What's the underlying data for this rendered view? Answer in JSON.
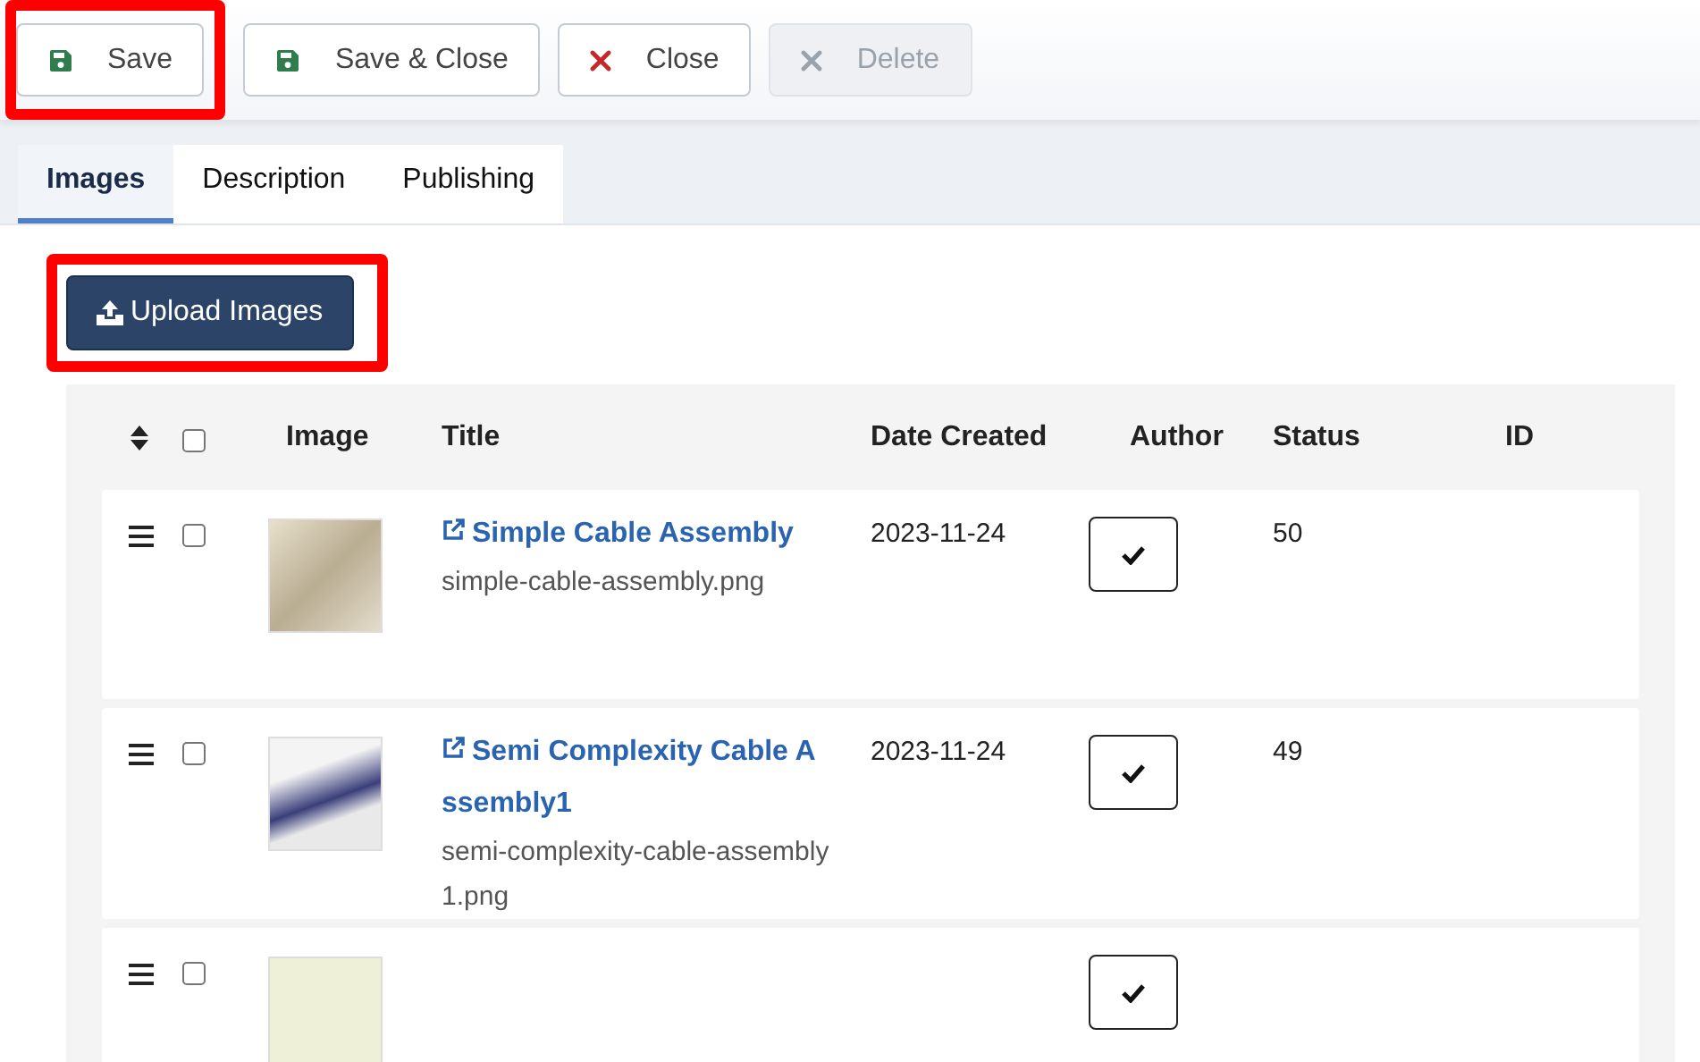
{
  "toolbar": {
    "buttons": [
      {
        "label": "Save",
        "kind": "save",
        "disabled": false,
        "highlighted": true
      },
      {
        "label": "Save & Close",
        "kind": "save",
        "disabled": false,
        "highlighted": false
      },
      {
        "label": "Close",
        "kind": "close",
        "disabled": false,
        "highlighted": false
      },
      {
        "label": "Delete",
        "kind": "close",
        "disabled": true,
        "highlighted": false
      }
    ]
  },
  "tabs": [
    {
      "label": "Images",
      "selected": true
    },
    {
      "label": "Description",
      "selected": false
    },
    {
      "label": "Publishing",
      "selected": false
    }
  ],
  "upload_button": {
    "label": "Upload Images",
    "highlighted": true
  },
  "table": {
    "select_all": {
      "checked": false
    },
    "columns": [
      "Image",
      "Title",
      "Date Created",
      "Author",
      "Status",
      "ID"
    ],
    "rows": [
      {
        "selected": false,
        "title": "Simple Cable Assembly",
        "filename": "simple-cable-assembly.png",
        "date": "2023-11-24",
        "author_checked": true,
        "status": "50"
      },
      {
        "selected": false,
        "title": "Semi Complexity Cable Assembly1",
        "filename": "semi-complexity-cable-assembly1.png",
        "date": "2023-11-24",
        "author_checked": true,
        "status": "49"
      },
      {
        "selected": false,
        "author_checked": true
      }
    ]
  }
}
